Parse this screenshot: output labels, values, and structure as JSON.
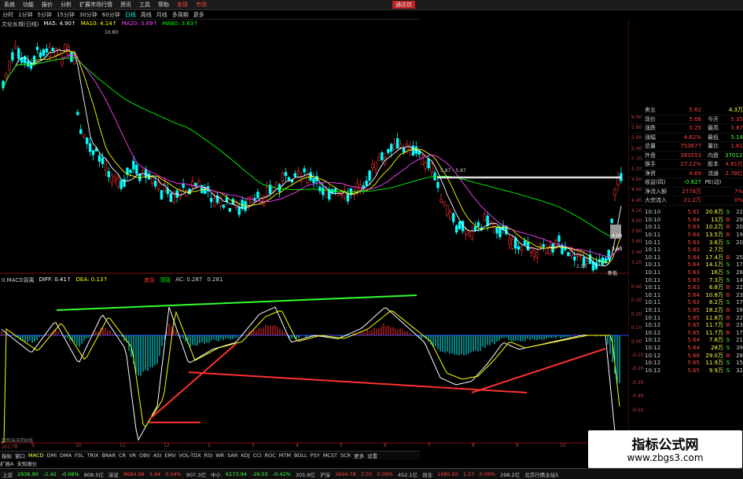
{
  "menubar": {
    "items": [
      "系统",
      "功能",
      "报价",
      "分析",
      "扩展市场行情",
      "资讯",
      "工具",
      "帮助"
    ],
    "hot": [
      "发现",
      "市场"
    ],
    "close": "通达信"
  },
  "periodbar": {
    "items": [
      "分时",
      "1分钟",
      "5分钟",
      "15分钟",
      "30分钟",
      "60分钟",
      "日线",
      "周线",
      "月线",
      "多周期",
      "更多"
    ],
    "active": "日线"
  },
  "stock": {
    "name": "文化长城(日线)"
  },
  "ma": {
    "ma5": "MA5: 4.90↑",
    "ma10": "MA10: 4.14↑",
    "ma20": "MA20: 3.69↑",
    "ma60": "MA60: 3.63↑"
  },
  "colors": {
    "ma5": "#ffffff",
    "ma10": "#ffff00",
    "ma20": "#ff40ff",
    "ma60": "#00ff00",
    "up": "#ff3030",
    "down": "#00ffff",
    "diff": "#ffffff",
    "dea": "#ffff00"
  },
  "price_labels": {
    "high": "10.80",
    "mid": "5.87 - 5.87",
    "low": "2.99",
    "pt1": "4.06",
    "pt2": "3.69",
    "new": "新低"
  },
  "price_axis": [
    "6.00",
    "5.80",
    "5.60",
    "5.40",
    "5.20",
    "5.00",
    "4.80",
    "4.60",
    "4.40",
    "4.20",
    "4.00",
    "3.80",
    "3.60",
    "3.40",
    "3.20"
  ],
  "macd_axis": [
    "0.40",
    "0.30",
    "0.20",
    "0.10",
    "0.00",
    "-0.10",
    "-0.20",
    "-0.30",
    "-0.40",
    "-0.50"
  ],
  "macd_legend": {
    "name": "0.MACD背离",
    "diff": "DIFF: 0.41↑",
    "dea": "DEA: 0.13↑",
    "dot": "底背",
    "dot2": "顶背",
    "ac": "AC: 0.287",
    "v": "0.281"
  },
  "quote": [
    {
      "label": "卖五",
      "price": "5.62",
      "vol": "4.3万"
    },
    {
      "label": "现价",
      "price": "5.66",
      "k2": "今开",
      "v2": "5.35"
    },
    {
      "label": "涨跌",
      "price": "0.25",
      "k2": "最高",
      "v2": "5.87"
    },
    {
      "label": "涨幅",
      "price": "4.62%",
      "k2": "最低",
      "v2": "5.14"
    },
    {
      "label": "总量",
      "price": "753677",
      "k2": "量比",
      "v2": "1.61"
    },
    {
      "label": "外盘",
      "price": "383553",
      "k2": "内盘",
      "v2": "370124"
    },
    {
      "label": "换手",
      "price": "27.12%",
      "k2": "股本",
      "v2": "4.81亿"
    },
    {
      "label": "净资",
      "price": "4.69",
      "k2": "流通",
      "v2": "2.78亿"
    },
    {
      "label": "收益(四)",
      "price": "-0.827",
      "k2": "PE(动)",
      "v2": ""
    },
    {
      "label": "净流入额",
      "price": "2778万",
      "k2": "",
      "v2": "7%"
    },
    {
      "label": "大宗流入",
      "price": "21.2万",
      "k2": "",
      "v2": "0%"
    }
  ],
  "ticks": [
    {
      "t": "10:10",
      "p": "5.61",
      "v": "20.8万",
      "d": "S",
      "n": "22"
    },
    {
      "t": "10:10",
      "p": "5.64",
      "v": "13万",
      "d": "B",
      "n": "29"
    },
    {
      "t": "10:11",
      "p": "5.63",
      "v": "10.2万",
      "d": "B",
      "n": "20"
    },
    {
      "t": "10:11",
      "p": "5.64",
      "v": "13.5万",
      "d": "B",
      "n": "19"
    },
    {
      "t": "10:11",
      "p": "5.63",
      "v": "3.6万",
      "d": "S",
      "n": "20"
    },
    {
      "t": "10:11",
      "p": "5.63",
      "v": "2.7万",
      "d": "",
      "n": ""
    },
    {
      "t": "10:11",
      "p": "5.64",
      "v": "17.4万",
      "d": "B",
      "n": "25"
    },
    {
      "t": "10:11",
      "p": "5.64",
      "v": "14.1万",
      "d": "S",
      "n": "17"
    },
    {
      "t": "10:11",
      "p": "5.63",
      "v": "16万",
      "d": "S",
      "n": "28"
    },
    {
      "t": "10:11",
      "p": "5.63",
      "v": "7.3万",
      "d": "S",
      "n": "14"
    },
    {
      "t": "10:11",
      "p": "5.63",
      "v": "6.8万",
      "d": "B",
      "n": "22"
    },
    {
      "t": "10:11",
      "p": "5.64",
      "v": "10.8万",
      "d": "B",
      "n": "23"
    },
    {
      "t": "10:11",
      "p": "5.63",
      "v": "8.2万",
      "d": "S",
      "n": "17"
    },
    {
      "t": "10:11",
      "p": "5.65",
      "v": "18.2万",
      "d": "B",
      "n": "16"
    },
    {
      "t": "10:11",
      "p": "5.65",
      "v": "11.8万",
      "d": "B",
      "n": "22"
    },
    {
      "t": "10:12",
      "p": "5.65",
      "v": "11.7万",
      "d": "B",
      "n": "23"
    },
    {
      "t": "10:12",
      "p": "5.65",
      "v": "11.7万",
      "d": "B",
      "n": "17"
    },
    {
      "t": "10:12",
      "p": "5.64",
      "v": "7.8万",
      "d": "S",
      "n": "21"
    },
    {
      "t": "10:12",
      "p": "5.64",
      "v": "28万",
      "d": "S",
      "n": "39"
    },
    {
      "t": "10:12",
      "p": "5.66",
      "v": "29.0万",
      "d": "B",
      "n": "28"
    },
    {
      "t": "10:12",
      "p": "5.65",
      "v": "11.9万",
      "d": "S",
      "n": "15"
    },
    {
      "t": "10:12",
      "p": "5.65",
      "v": "9.9万",
      "d": "S",
      "n": "32"
    }
  ],
  "ind_tabs": [
    "指标",
    "窗口",
    "MACD",
    "DMI",
    "DMA",
    "FSL",
    "TRIX",
    "BRAR",
    "CR",
    "VR",
    "OBV",
    "ASI",
    "EMV",
    "VOL-TDX",
    "RSI",
    "WR",
    "SAR",
    "KDJ",
    "CCI",
    "ROC",
    "MTM",
    "BOLL",
    "PSY",
    "MCST",
    "SCR",
    "更多",
    "设置"
  ],
  "sub_tabs": [
    "扩展A",
    "未知报价"
  ],
  "hint": "回到当天的K线",
  "status": [
    {
      "name": "上证",
      "val": "2936.90",
      "chg": "-2.42",
      "pct": "-0.08%",
      "amt": "808.5亿"
    },
    {
      "name": "深证",
      "val": "9684.98",
      "chg": "3.44",
      "pct": "0.04%",
      "amt": "907.3亿"
    },
    {
      "name": "中小",
      "val": "6173.94",
      "chg": "-26.03",
      "pct": "-0.42%",
      "amt": "305.9亿"
    },
    {
      "name": "沪深",
      "val": "3694.78",
      "chg": "3.55",
      "pct": "0.09%",
      "amt": "452.1亿"
    },
    {
      "name": "创业",
      "val": "1685.65",
      "chg": "1.57",
      "pct": "0.09%",
      "amt": "298.2亿"
    }
  ],
  "status_right": "北京行情主站5",
  "watermark": {
    "title": "指标公式网",
    "url": "www.zbgs3.com"
  },
  "date_label": "2017年",
  "month_labels": [
    "9",
    "10",
    "11",
    "12",
    "2",
    "3",
    "4",
    "5",
    "6",
    "7",
    "8",
    "9",
    "10"
  ]
}
